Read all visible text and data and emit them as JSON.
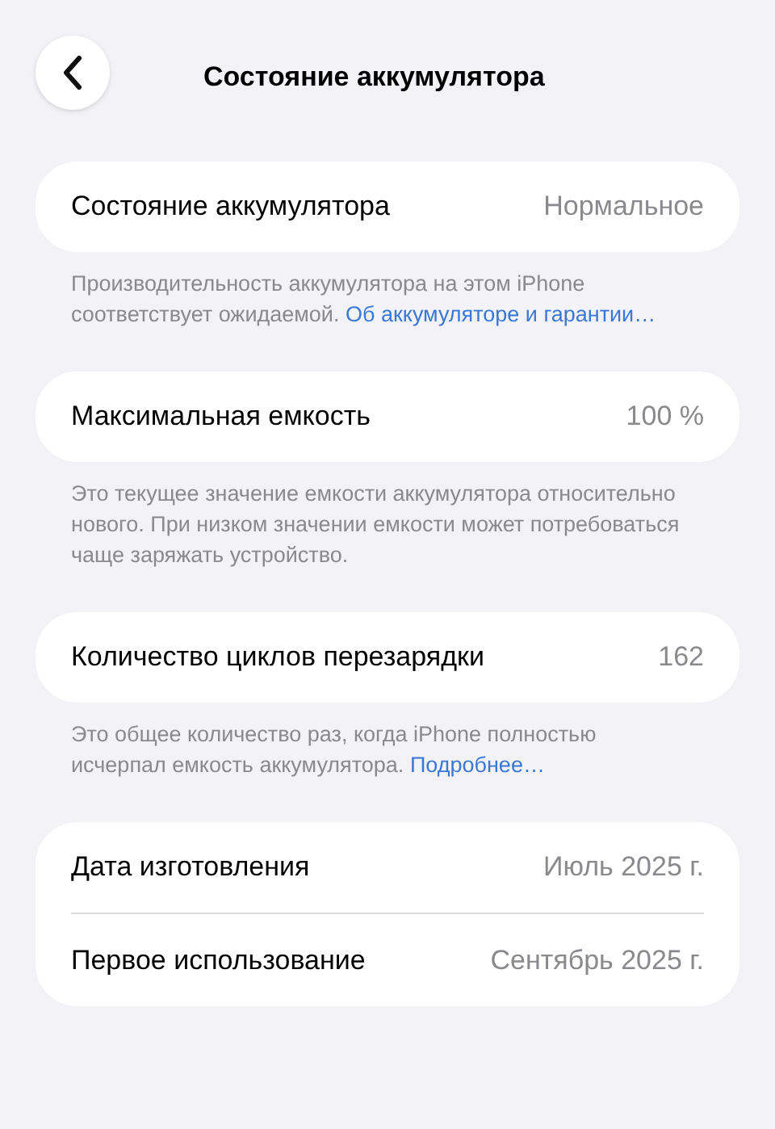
{
  "nav": {
    "title": "Состояние аккумулятора"
  },
  "sections": [
    {
      "rows": [
        {
          "label": "Состояние аккумулятора",
          "value": "Нормальное"
        }
      ],
      "footer": {
        "text": "Производительность аккумулятора на этом iPhone соответствует ожидаемой.",
        "link": "Об аккумуляторе и гарантии…"
      }
    },
    {
      "rows": [
        {
          "label": "Максимальная емкость",
          "value": "100 %"
        }
      ],
      "footer": {
        "text": "Это текущее значение емкости аккумулятора относительно нового. При низком значении емкости может потребоваться чаще заряжать устройство."
      }
    },
    {
      "rows": [
        {
          "label": "Количество циклов перезарядки",
          "value": "162"
        }
      ],
      "footer": {
        "text": "Это общее количество раз, когда iPhone полностью исчерпал емкость аккумулятора.",
        "link": "Подробнее…"
      }
    },
    {
      "rows": [
        {
          "label": "Дата изготовления",
          "value": "Июль 2025 г."
        },
        {
          "label": "Первое использование",
          "value": "Сентябрь 2025 г."
        }
      ]
    }
  ]
}
